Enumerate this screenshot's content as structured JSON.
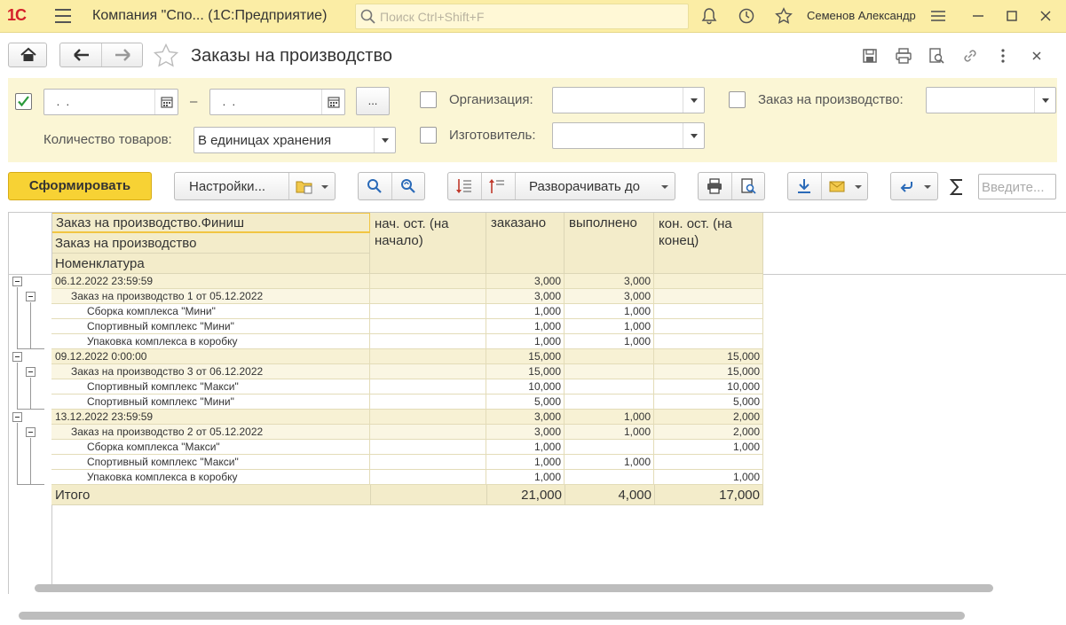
{
  "app": {
    "logo": "1С",
    "title": "Компания \"Спо...  (1С:Предприятие)",
    "search_placeholder": "Поиск Ctrl+Shift+F",
    "user": "Семенов Александр"
  },
  "page": {
    "title": "Заказы на производство"
  },
  "filters": {
    "date_from": " .  .",
    "date_to": " .  .",
    "dash": "–",
    "ellipsis": "...",
    "org_label": "Организация:",
    "order_label": "Заказ на производство:",
    "maker_label": "Изготовитель:",
    "qty_label": "Количество товаров:",
    "qty_value": "В единицах хранения"
  },
  "toolbar": {
    "form": "Сформировать",
    "settings": "Настройки...",
    "expand": "Разворачивать до",
    "input_placeholder": "Введите..."
  },
  "report": {
    "header": {
      "group1": "Заказ на производство.Финиш",
      "group2": "Заказ на производство",
      "group3": "Номенклатура",
      "col1": "нач. ост. (на начало)",
      "col2": "заказано",
      "col3": "выполнено",
      "col4": "кон. ост. (на конец)"
    },
    "rows": [
      {
        "level": 0,
        "name": "06.12.2022 23:59:59",
        "start": "",
        "ordered": "3,000",
        "done": "3,000",
        "end": ""
      },
      {
        "level": 1,
        "name": "Заказ на производство 1 от 05.12.2022",
        "start": "",
        "ordered": "3,000",
        "done": "3,000",
        "end": ""
      },
      {
        "level": 2,
        "name": "Сборка комплекса \"Мини\"",
        "start": "",
        "ordered": "1,000",
        "done": "1,000",
        "end": ""
      },
      {
        "level": 2,
        "name": "Спортивный комплекс \"Мини\"",
        "start": "",
        "ordered": "1,000",
        "done": "1,000",
        "end": ""
      },
      {
        "level": 2,
        "name": "Упаковка комплекса в коробку",
        "start": "",
        "ordered": "1,000",
        "done": "1,000",
        "end": ""
      },
      {
        "level": 0,
        "name": "09.12.2022 0:00:00",
        "start": "",
        "ordered": "15,000",
        "done": "",
        "end": "15,000"
      },
      {
        "level": 1,
        "name": "Заказ на производство 3 от 06.12.2022",
        "start": "",
        "ordered": "15,000",
        "done": "",
        "end": "15,000"
      },
      {
        "level": 2,
        "name": "Спортивный комплекс \"Макси\"",
        "start": "",
        "ordered": "10,000",
        "done": "",
        "end": "10,000"
      },
      {
        "level": 2,
        "name": "Спортивный комплекс \"Мини\"",
        "start": "",
        "ordered": "5,000",
        "done": "",
        "end": "5,000"
      },
      {
        "level": 0,
        "name": "13.12.2022 23:59:59",
        "start": "",
        "ordered": "3,000",
        "done": "1,000",
        "end": "2,000"
      },
      {
        "level": 1,
        "name": "Заказ на производство 2 от 05.12.2022",
        "start": "",
        "ordered": "3,000",
        "done": "1,000",
        "end": "2,000"
      },
      {
        "level": 2,
        "name": "Сборка комплекса \"Макси\"",
        "start": "",
        "ordered": "1,000",
        "done": "",
        "end": "1,000"
      },
      {
        "level": 2,
        "name": "Спортивный комплекс \"Макси\"",
        "start": "",
        "ordered": "1,000",
        "done": "1,000",
        "end": ""
      },
      {
        "level": 2,
        "name": "Упаковка комплекса в коробку",
        "start": "",
        "ordered": "1,000",
        "done": "",
        "end": "1,000"
      }
    ],
    "total": {
      "name": "Итого",
      "start": "",
      "ordered": "21,000",
      "done": "4,000",
      "end": "17,000"
    }
  }
}
